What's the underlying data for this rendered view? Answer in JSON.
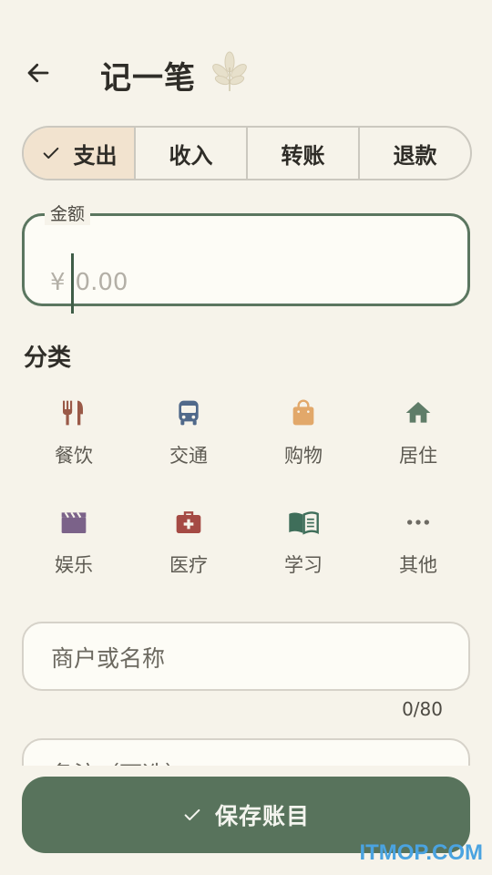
{
  "header": {
    "title": "记一笔",
    "back_icon": "arrow-left-icon",
    "decor_icon": "leaf-icon"
  },
  "type_tabs": [
    {
      "label": "支出",
      "selected": true
    },
    {
      "label": "收入",
      "selected": false
    },
    {
      "label": "转账",
      "selected": false
    },
    {
      "label": "退款",
      "selected": false
    }
  ],
  "amount": {
    "label": "金额",
    "currency": "¥",
    "placeholder": "0.00"
  },
  "category_section": {
    "title": "分类",
    "items": [
      {
        "label": "餐饮",
        "icon": "utensils-icon",
        "color": "#9a5a48"
      },
      {
        "label": "交通",
        "icon": "bus-icon",
        "color": "#50698a"
      },
      {
        "label": "购物",
        "icon": "shopping-bag-icon",
        "color": "#e2a86a"
      },
      {
        "label": "居住",
        "icon": "home-icon",
        "color": "#5f7c68"
      },
      {
        "label": "娱乐",
        "icon": "clapperboard-icon",
        "color": "#7b6289"
      },
      {
        "label": "医疗",
        "icon": "medical-kit-icon",
        "color": "#a54a44"
      },
      {
        "label": "学习",
        "icon": "open-book-icon",
        "color": "#3f6e5a"
      },
      {
        "label": "其他",
        "icon": "more-horizontal-icon",
        "color": "#6d6a63"
      }
    ]
  },
  "merchant": {
    "placeholder": "商户或名称",
    "counter": "0/80"
  },
  "note": {
    "placeholder": "备注（可选）"
  },
  "save_button": {
    "label": "保存账目"
  },
  "watermark": "ITMOP.COM",
  "colors": {
    "accent": "#58735c",
    "background": "#f6f3ea",
    "selected_tab": "#f2e3cf"
  }
}
